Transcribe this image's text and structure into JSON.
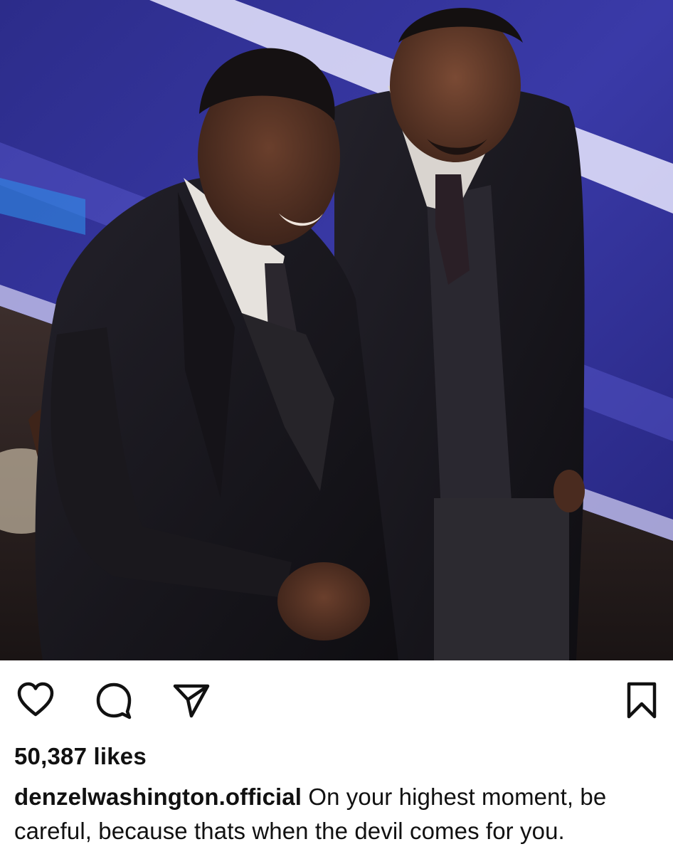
{
  "post": {
    "photo": {
      "icon": "photo-image",
      "colors": {
        "background": "#1c1a3d",
        "stage_blue": "#3a3a9e",
        "stage_light": "#e8e6ff",
        "suit": "#17151a"
      }
    },
    "actions": {
      "like_icon": "heart-icon",
      "comment_icon": "comment-icon",
      "share_icon": "paper-plane-icon",
      "save_icon": "bookmark-icon"
    },
    "likes_text": "50,387 likes",
    "caption": {
      "username": "denzelwashington.official",
      "text": "On your highest moment, be careful, because thats when the devil comes for you."
    }
  }
}
